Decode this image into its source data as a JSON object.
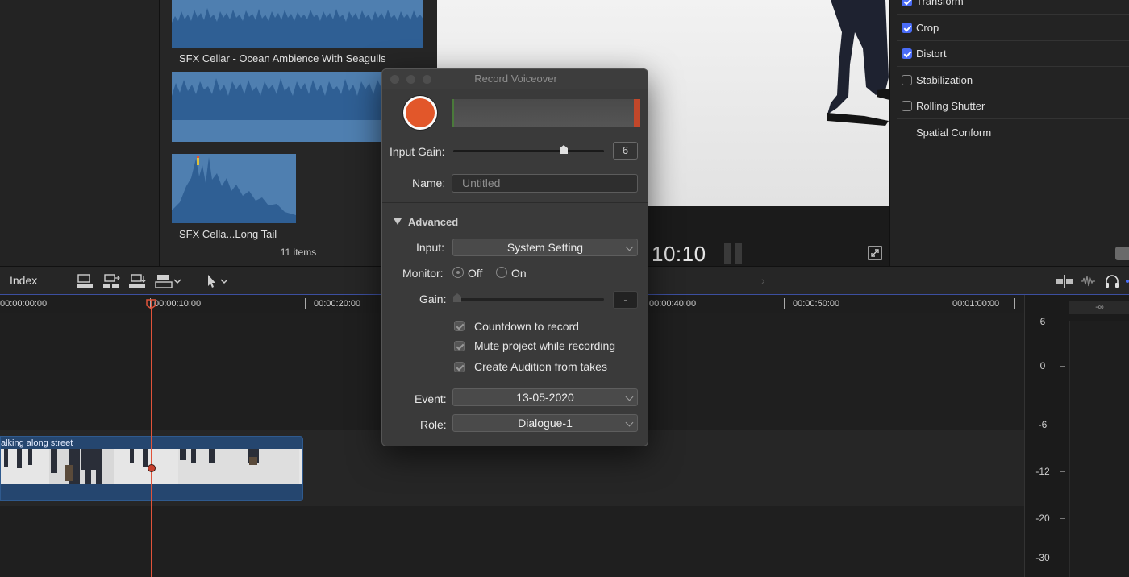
{
  "browser": {
    "clip1_label": "SFX Cellar - Ocean Ambience With Seagulls",
    "clip3_label": "SFX Cella...Long Tail",
    "items_count": "11 items"
  },
  "viewer": {
    "timecode": "10:10"
  },
  "inspector": {
    "items": [
      {
        "label": "Transform",
        "checked": true
      },
      {
        "label": "Crop",
        "checked": true
      },
      {
        "label": "Distort",
        "checked": true
      },
      {
        "label": "Stabilization",
        "checked": false
      },
      {
        "label": "Rolling Shutter",
        "checked": false
      },
      {
        "label": "Spatial Conform",
        "checked": null
      }
    ]
  },
  "timeline": {
    "index_label": "Index",
    "ruler": [
      "00:00:00:00",
      "00:00:10:00",
      "00:00:20:00",
      "00:00:40:00",
      "00:00:50:00",
      "00:01:00:00"
    ],
    "clip_title": "alking along street"
  },
  "meters": {
    "peak": "-∞",
    "labels": [
      "6",
      "0",
      "-6",
      "-12",
      "-20",
      "-30"
    ]
  },
  "dialog": {
    "title": "Record Voiceover",
    "input_gain_label": "Input Gain:",
    "input_gain_value": "6",
    "name_label": "Name:",
    "name_placeholder": "Untitled",
    "advanced_label": "Advanced",
    "input_label": "Input:",
    "input_value": "System Setting",
    "monitor_label": "Monitor:",
    "monitor_off": "Off",
    "monitor_on": "On",
    "gain_label": "Gain:",
    "gain_value": "-",
    "countdown_label": "Countdown to record",
    "mute_label": "Mute project while recording",
    "audition_label": "Create Audition from takes",
    "event_label": "Event:",
    "event_value": "13-05-2020",
    "role_label": "Role:",
    "role_value": "Dialogue-1"
  },
  "colors": {
    "record": "#e2572a",
    "checkbox_accent": "#4a6cf7",
    "playhead": "#e0533a",
    "audio_clip": "#4f7fb0",
    "video_clip": "#25466f"
  }
}
